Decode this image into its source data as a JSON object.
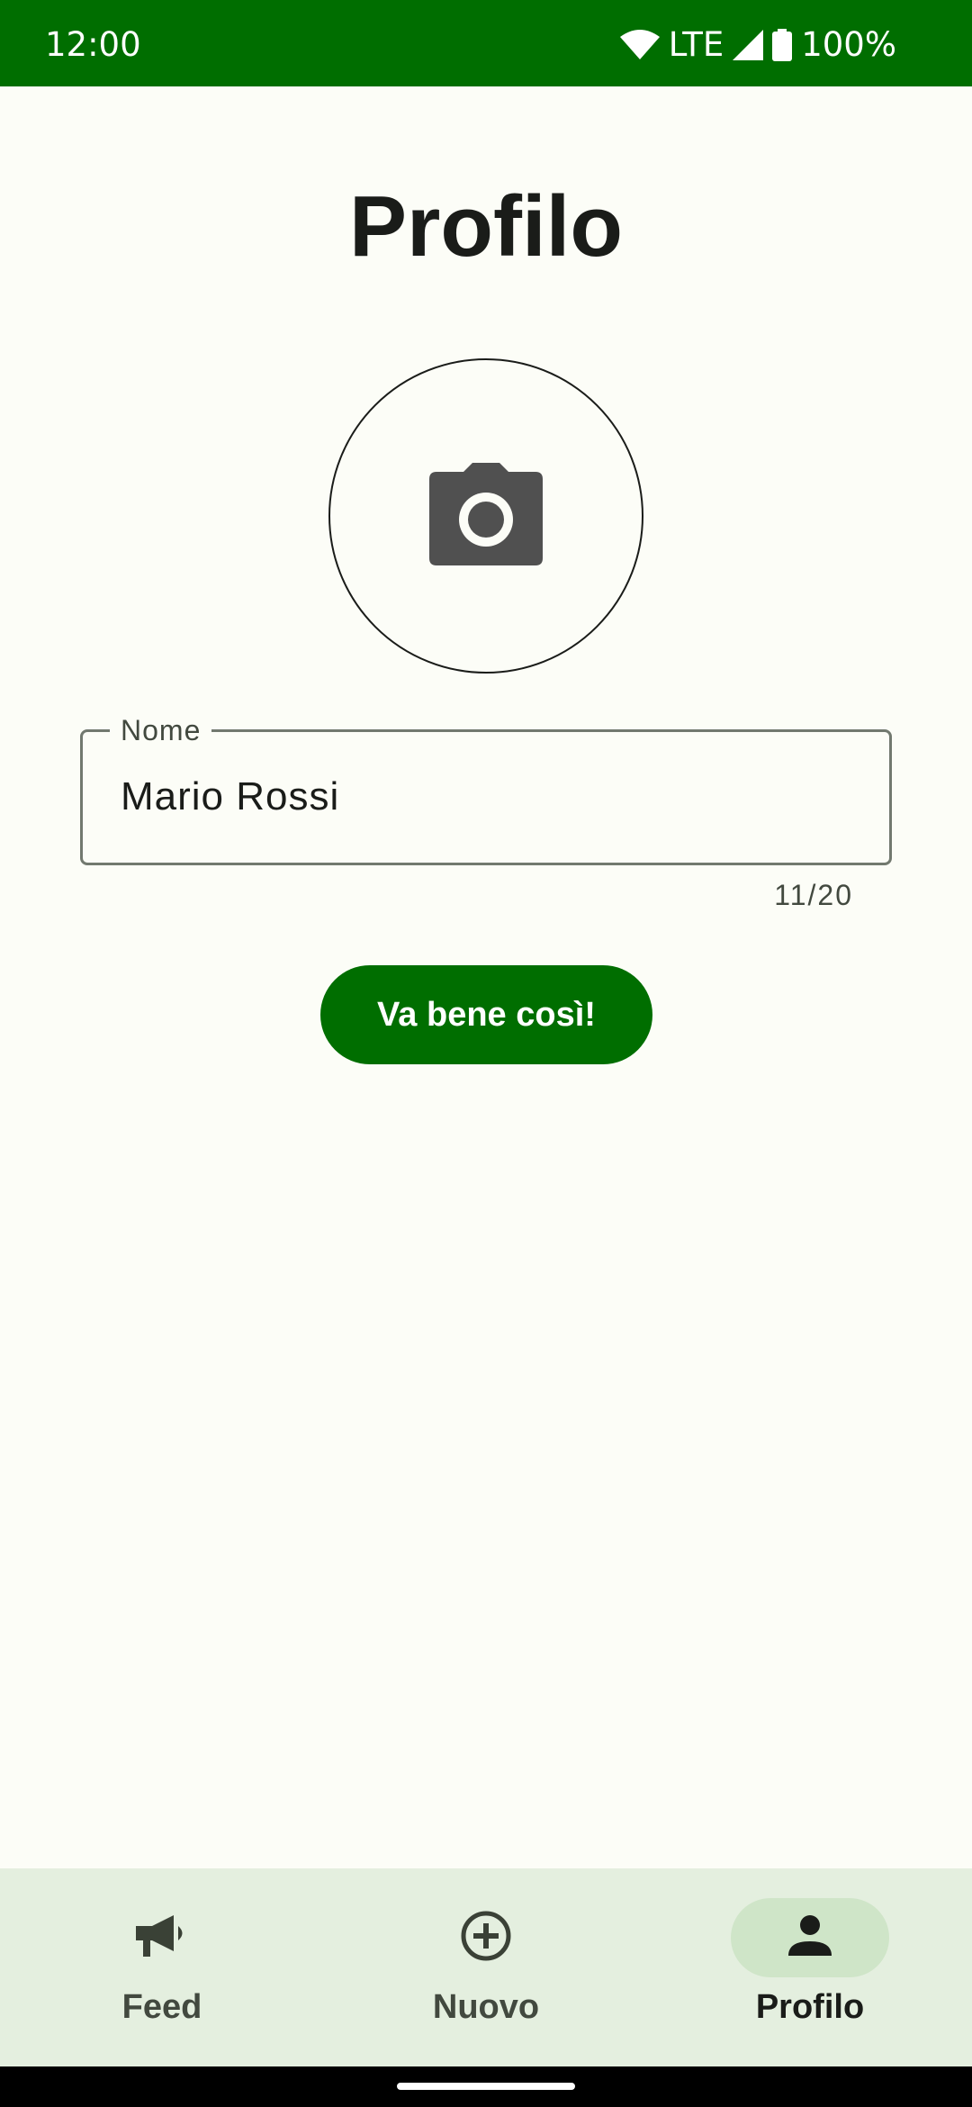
{
  "status_bar": {
    "time": "12:00",
    "network": "LTE",
    "battery": "100%",
    "icons": [
      "wifi-icon",
      "signal-icon",
      "battery-icon"
    ]
  },
  "page": {
    "title": "Profilo"
  },
  "avatar": {
    "icon": "camera-icon"
  },
  "name_field": {
    "label": "Nome",
    "value": "Mario Rossi",
    "counter": "11/20"
  },
  "confirm_button": {
    "label": "Va bene così!"
  },
  "bottom_nav": {
    "items": [
      {
        "label": "Feed",
        "icon": "megaphone-icon",
        "active": false
      },
      {
        "label": "Nuovo",
        "icon": "add-circle-icon",
        "active": false
      },
      {
        "label": "Profilo",
        "icon": "person-icon",
        "active": true
      }
    ]
  },
  "colors": {
    "primary": "#006e00",
    "background": "#fcfdf7",
    "nav_background": "#e4efdf",
    "nav_active_pill": "#cfe5c8"
  }
}
